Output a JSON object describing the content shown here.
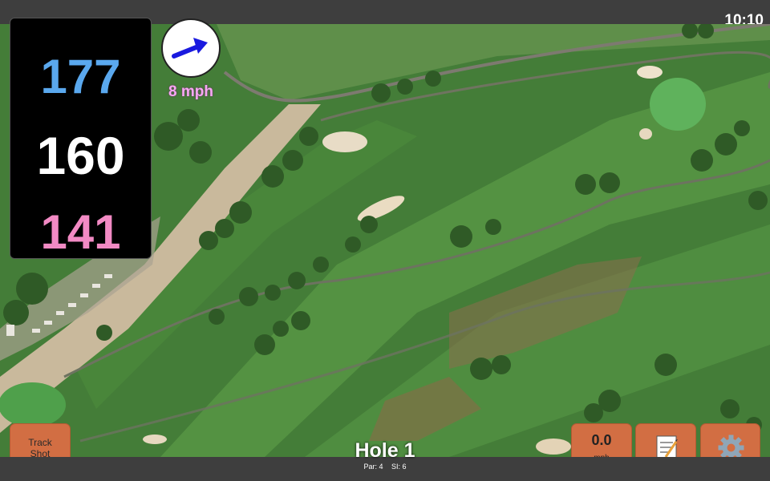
{
  "status_bar": {
    "time": "10:10"
  },
  "distances": {
    "back": "177",
    "middle": "160",
    "front": "141"
  },
  "wind": {
    "speed_label": "8 mph",
    "direction_icon": "arrow-icon"
  },
  "buttons": {
    "track_shot_line1": "Track",
    "track_shot_line2": "Shot",
    "speed_value": "0.0",
    "speed_unit": "mph",
    "notes_icon": "notepad-icon",
    "settings_icon": "gear-icon"
  },
  "hole": {
    "title": "Hole 1",
    "par": "Par: 4",
    "si": "SI: 6"
  },
  "colors": {
    "back_distance": "#5aa8ee",
    "middle_distance": "#ffffff",
    "front_distance": "#f28ac4",
    "wind_text": "#f7a7f3",
    "button": "#d26e43",
    "wind_arrow": "#1a1adf"
  }
}
